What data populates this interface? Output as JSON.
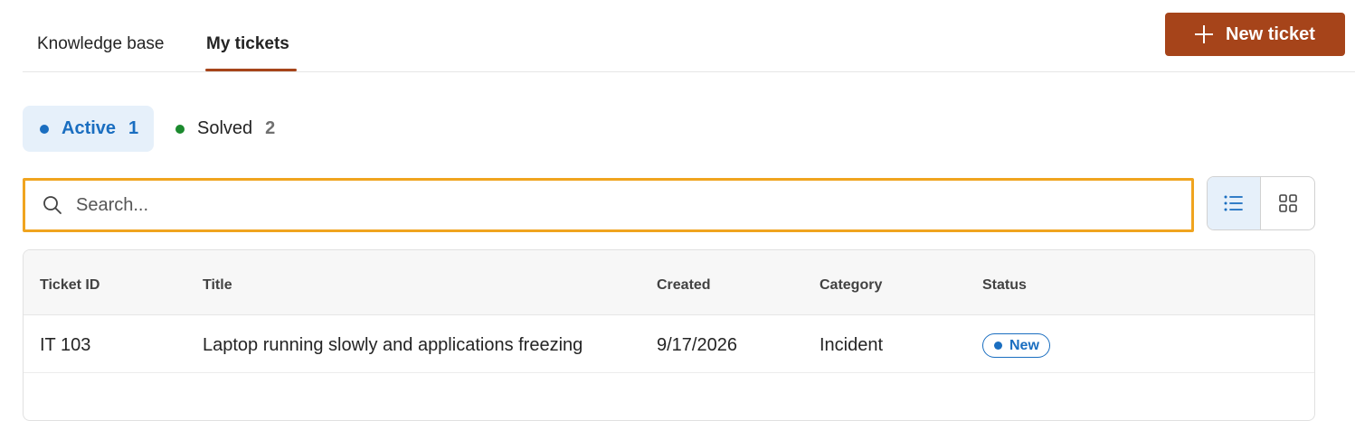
{
  "tabs": [
    {
      "label": "Knowledge base"
    },
    {
      "label": "My tickets"
    }
  ],
  "new_ticket_button": {
    "label": "New ticket",
    "icon": "plus-icon"
  },
  "filters": [
    {
      "label": "Active",
      "count": "1",
      "color": "#1a6ec0"
    },
    {
      "label": "Solved",
      "count": "2",
      "color": "#1b8a2e"
    }
  ],
  "search": {
    "placeholder": "Search...",
    "value": ""
  },
  "view_toggle": {
    "options": [
      "list-view-icon",
      "grid-view-icon"
    ],
    "selected": "list"
  },
  "table": {
    "columns": [
      "Ticket ID",
      "Title",
      "Created",
      "Category",
      "Status"
    ],
    "rows": [
      {
        "ticket_id": "IT 103",
        "title": "Laptop running slowly and applications freezing",
        "created": "9/17/2026",
        "category": "Incident",
        "status": "New"
      }
    ]
  },
  "colors": {
    "accent": "#a6441a",
    "focus_outline": "#f0a41f",
    "primary_blue": "#1a6ec0"
  }
}
